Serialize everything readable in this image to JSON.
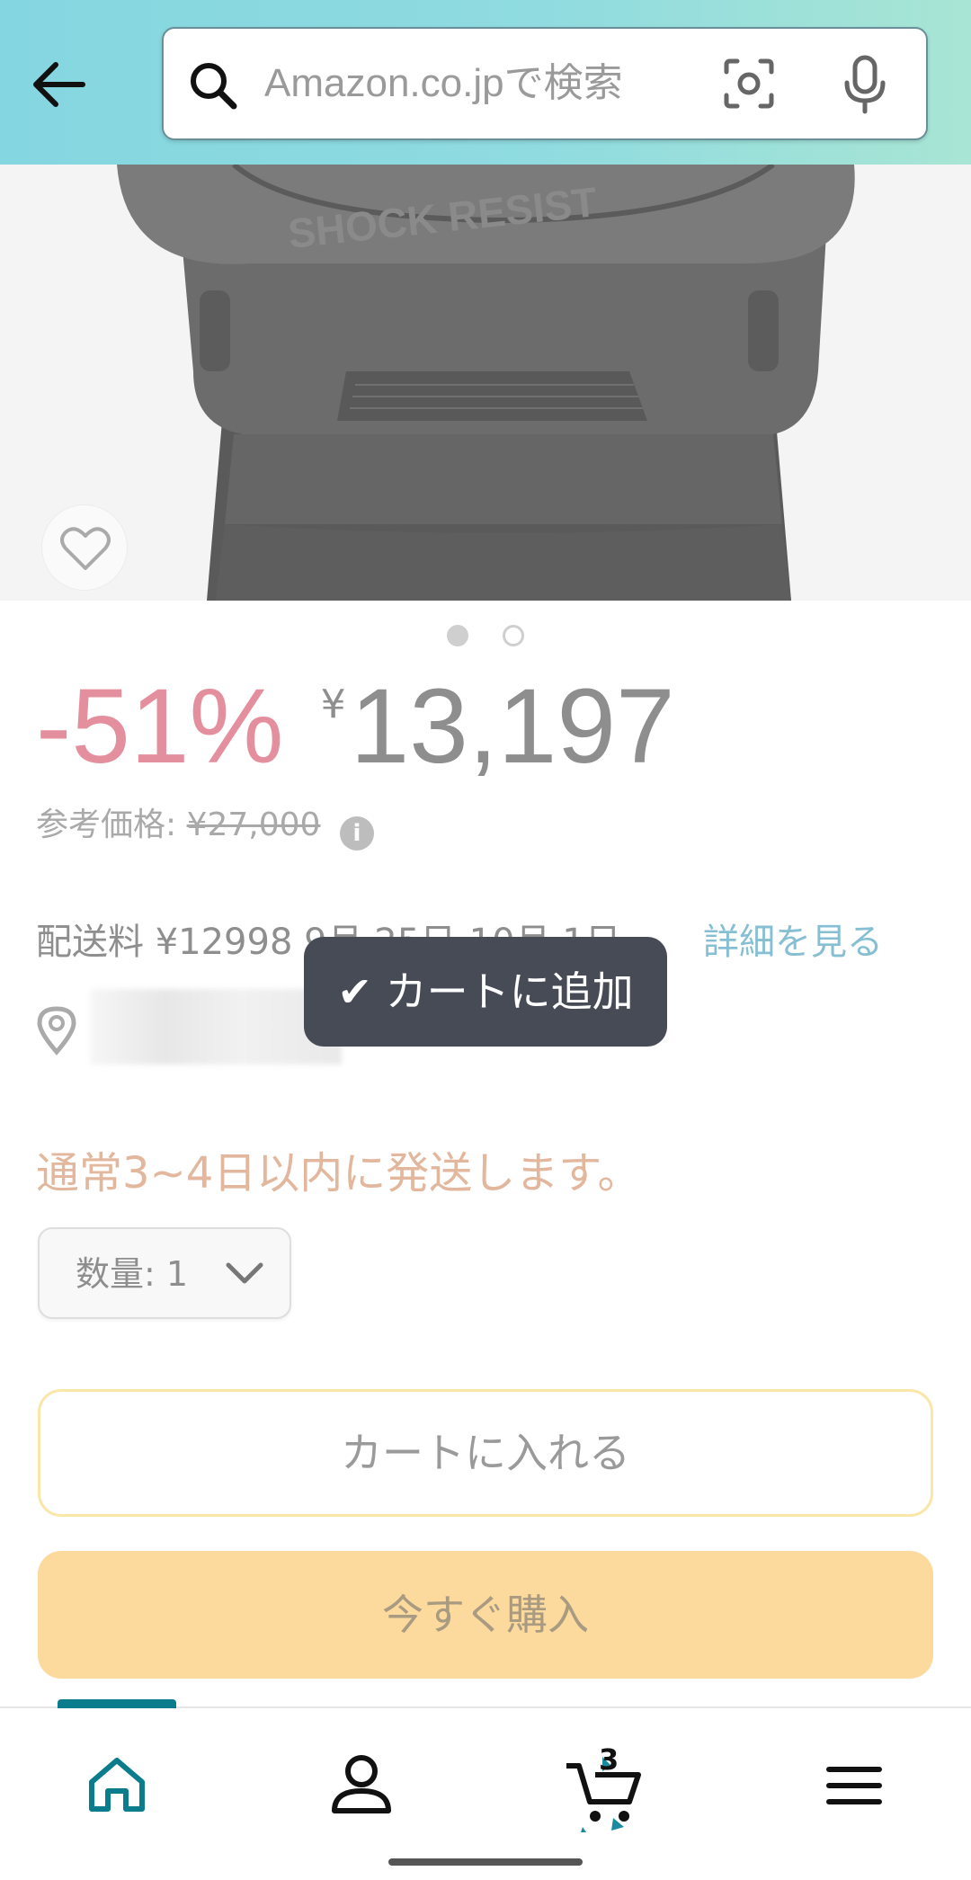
{
  "header": {
    "search_placeholder": "Amazon.co.jpで検索"
  },
  "product": {
    "image_text": "SHOCK RESIST",
    "discount": "-51%",
    "currency_symbol": "¥",
    "price": "13,197",
    "ref_label": "参考価格:",
    "ref_price": "¥27,000"
  },
  "delivery": {
    "text": "配送料 ¥12998 9月 25日-10月 1日。",
    "detail_link": "詳細を見る"
  },
  "toast": {
    "text": "✔ カートに追加"
  },
  "stock": {
    "message": "通常3~4日以内に発送します。"
  },
  "quantity": {
    "label": "数量: 1"
  },
  "buttons": {
    "add_to_cart": "カートに入れる",
    "buy_now": "今すぐ購入"
  },
  "nav": {
    "cart_count": "3",
    "items": [
      "home",
      "account",
      "cart",
      "menu"
    ]
  },
  "colors": {
    "discount": "#e48f9e",
    "link": "#86bfd3",
    "stock": "#e2b79d",
    "buy_button": "#fcd99d",
    "cart_border": "#fbe6a7",
    "toast_bg": "#464b55",
    "nav_active": "#0b7c8b"
  }
}
